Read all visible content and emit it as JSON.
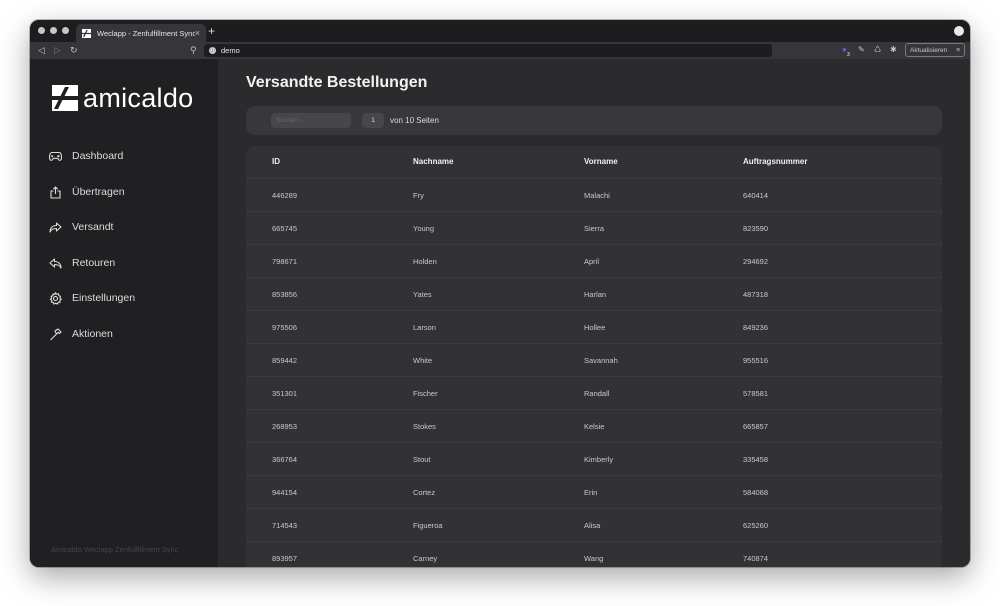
{
  "browser": {
    "tab_title": "Weclapp - Zenfulfillment Sync",
    "tab_close": "×",
    "new_tab": "+",
    "url": "demo",
    "update_button": "Aktualisieren",
    "menu_icon": "≡",
    "extension_badge": "3"
  },
  "sidebar": {
    "logo_text": "amicaldo",
    "items": [
      {
        "label": "Dashboard",
        "icon": "gamepad-icon"
      },
      {
        "label": "Übertragen",
        "icon": "share-icon"
      },
      {
        "label": "Versandt",
        "icon": "forward-arrow-icon"
      },
      {
        "label": "Retouren",
        "icon": "reply-arrow-icon"
      },
      {
        "label": "Einstellungen",
        "icon": "gear-icon"
      },
      {
        "label": "Aktionen",
        "icon": "hammer-icon"
      }
    ],
    "footer": "Amicaldo Weclapp Zenfulfillment Sync"
  },
  "main": {
    "title": "Versandte Bestellungen",
    "search": {
      "placeholder": "Suchen..."
    },
    "pagination": {
      "current_page": "1",
      "label": "von 10 Seiten"
    }
  },
  "table": {
    "columns": [
      "ID",
      "Nachname",
      "Vorname",
      "Auftragsnummer"
    ],
    "rows": [
      [
        "446289",
        "Fry",
        "Malachi",
        "640414"
      ],
      [
        "665745",
        "Young",
        "Sierra",
        "823590"
      ],
      [
        "798671",
        "Holden",
        "April",
        "294692"
      ],
      [
        "853856",
        "Yates",
        "Harlan",
        "487318"
      ],
      [
        "975506",
        "Larson",
        "Hollee",
        "849236"
      ],
      [
        "859442",
        "White",
        "Savannah",
        "955516"
      ],
      [
        "351301",
        "Fischer",
        "Randall",
        "578581"
      ],
      [
        "268953",
        "Stokes",
        "Kelsie",
        "665857"
      ],
      [
        "366764",
        "Stout",
        "Kimberly",
        "335458"
      ],
      [
        "944154",
        "Cortez",
        "Erin",
        "584068"
      ],
      [
        "714543",
        "Figueroa",
        "Alisa",
        "625260"
      ],
      [
        "893957",
        "Carney",
        "Wang",
        "740874"
      ]
    ]
  },
  "colors": {
    "sidebar_bg": "#202023",
    "main_bg": "#2b2b2e",
    "card_bg": "#323236",
    "text": "#dcdcdc"
  }
}
